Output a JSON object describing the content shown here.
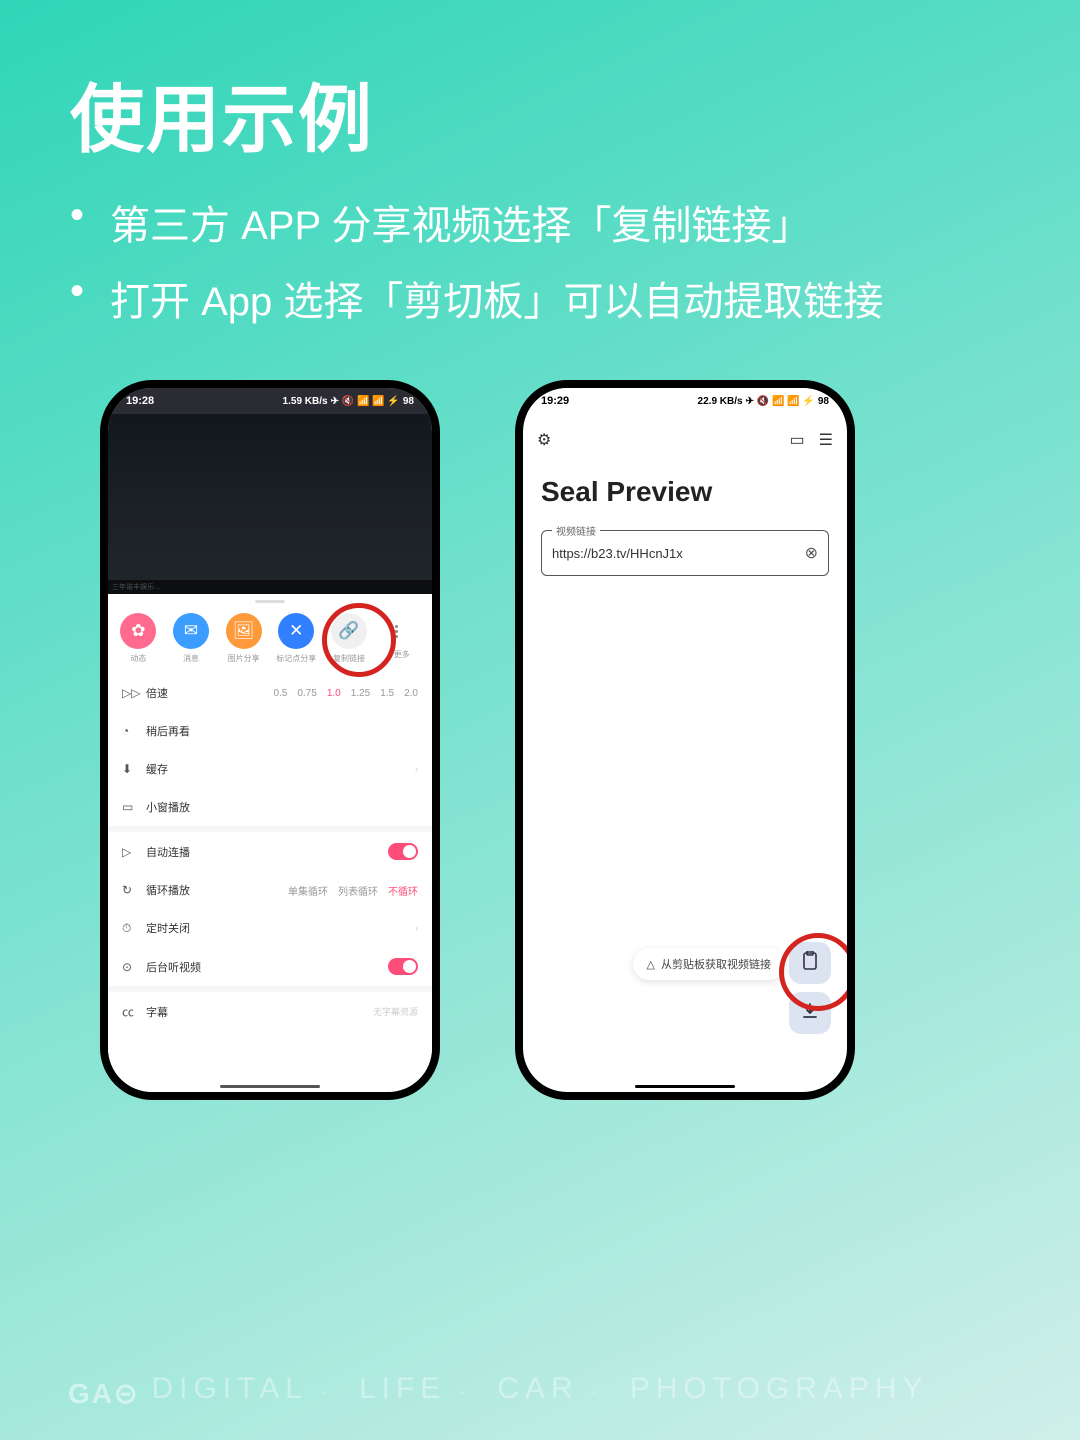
{
  "slide": {
    "title": "使用示例",
    "bullets": [
      "第三方 APP 分享视频选择「复制链接」",
      "打开 App 选择「剪切板」可以自动提取链接"
    ]
  },
  "phone1": {
    "status_time": "19:28",
    "status_speed": "1.59 KB/s",
    "status_battery": "98",
    "share_items": [
      {
        "label": "动态",
        "icon": "✿"
      },
      {
        "label": "消息",
        "icon": "✉"
      },
      {
        "label": "图片分享",
        "icon": "🖼"
      },
      {
        "label": "标记点分享",
        "icon": "✕"
      },
      {
        "label": "复制链接",
        "icon": "🔗"
      },
      {
        "label": "更多",
        "icon": "⋮"
      }
    ],
    "speed": {
      "label": "倍速",
      "options": [
        "0.5",
        "0.75",
        "1.0",
        "1.25",
        "1.5",
        "2.0"
      ],
      "selected": "1.0"
    },
    "later": "稍后再看",
    "cache": "缓存",
    "pip": "小窗播放",
    "autoplay": "自动连播",
    "loop": {
      "label": "循环播放",
      "options": [
        "单集循环",
        "列表循环",
        "不循环"
      ],
      "selected": "不循环"
    },
    "timer": "定时关闭",
    "bg_listen": "后台听视频",
    "subtitle": {
      "label": "字幕",
      "hint": "无字幕资源"
    }
  },
  "phone2": {
    "status_time": "19:29",
    "status_speed": "22.9 KB/s",
    "status_battery": "98",
    "app_title": "Seal Preview",
    "field_label": "视频链接",
    "field_value": "https://b23.tv/HHcnJ1x",
    "tooltip": "从剪贴板获取视频链接"
  },
  "footer": {
    "logo": "GA⊝",
    "words": [
      "DIGITAL",
      "LIFE",
      "CAR",
      "PHOTOGRAPHY"
    ]
  }
}
